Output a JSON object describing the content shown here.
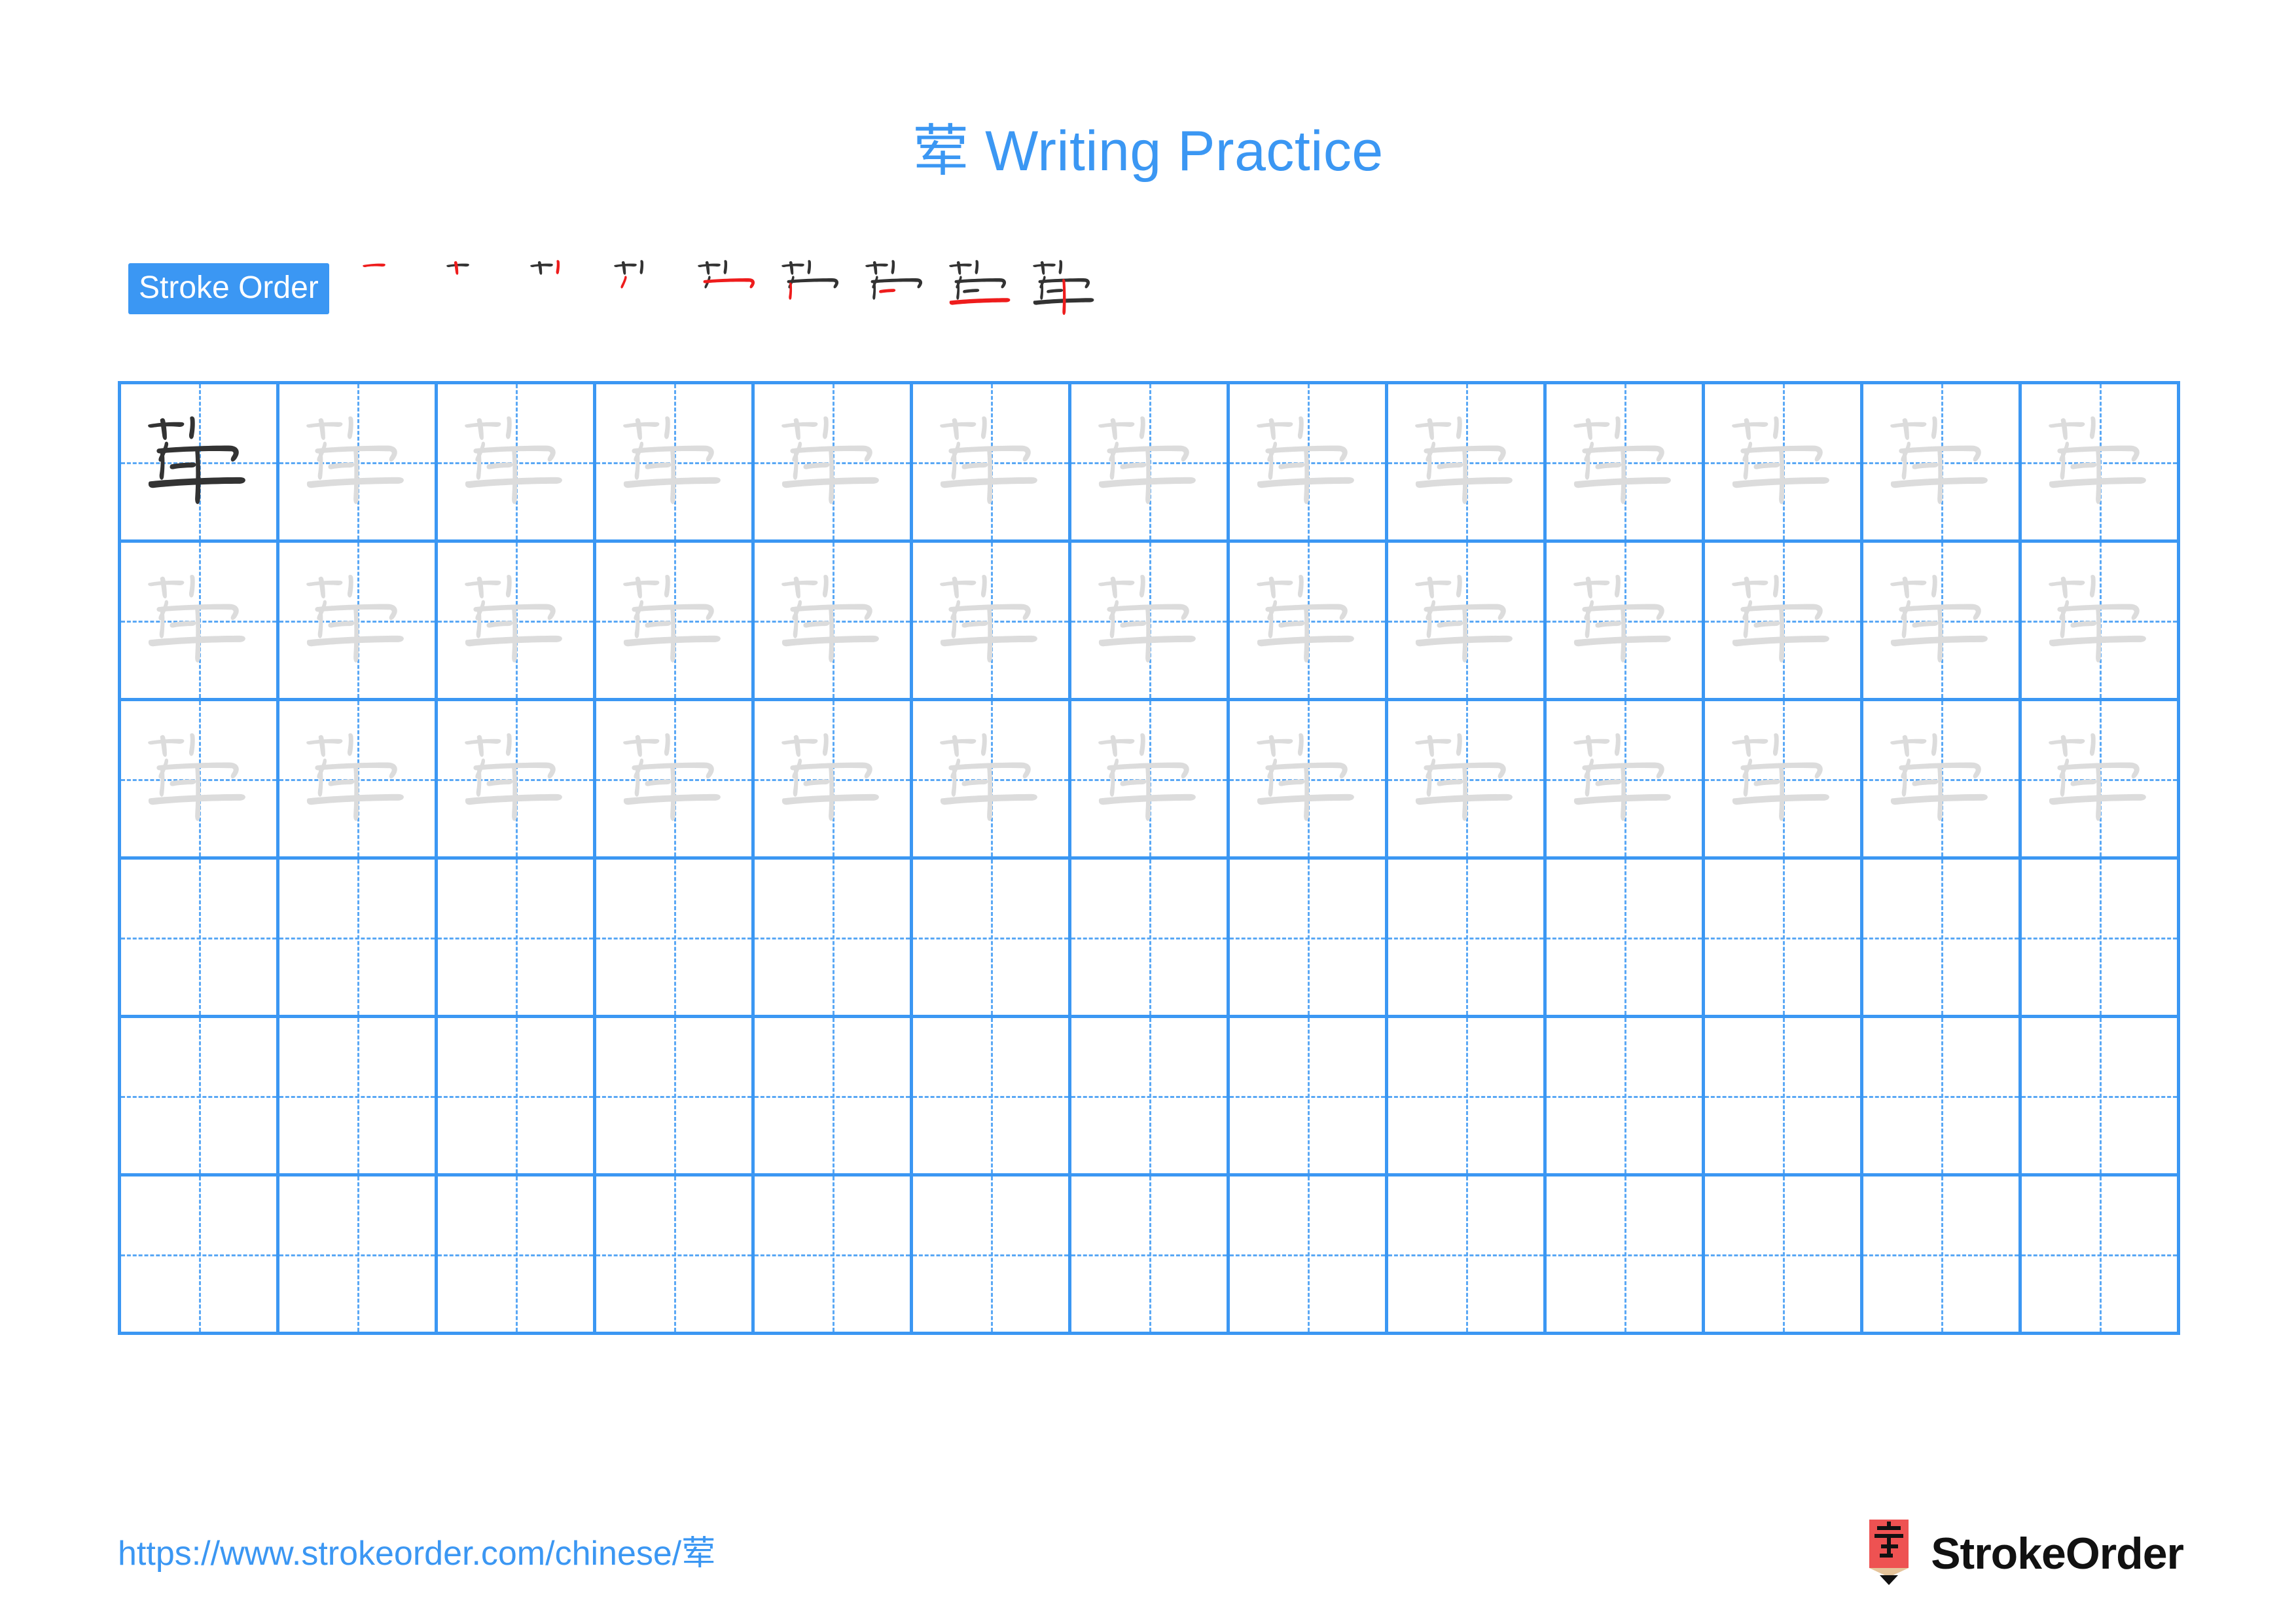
{
  "page": {
    "character": "荤",
    "title_suffix": " Writing Practice",
    "title_full": "荤 Writing Practice",
    "accent_color": "#3b97f3",
    "trace_color": "#dcdcdc",
    "ink_color": "#333333",
    "highlight_stroke_color": "#ee1c1c",
    "grid_line_color": "#3b97f3",
    "grid_dash_color": "#5aa8f5"
  },
  "stroke_order": {
    "badge_label": "Stroke Order",
    "stroke_count": 9,
    "steps": [
      {
        "index": 1,
        "name": "stroke-step-1",
        "strokes_drawn": 1
      },
      {
        "index": 2,
        "name": "stroke-step-2",
        "strokes_drawn": 2
      },
      {
        "index": 3,
        "name": "stroke-step-3",
        "strokes_drawn": 3
      },
      {
        "index": 4,
        "name": "stroke-step-4",
        "strokes_drawn": 4
      },
      {
        "index": 5,
        "name": "stroke-step-5",
        "strokes_drawn": 5
      },
      {
        "index": 6,
        "name": "stroke-step-6",
        "strokes_drawn": 6
      },
      {
        "index": 7,
        "name": "stroke-step-7",
        "strokes_drawn": 7
      },
      {
        "index": 8,
        "name": "stroke-step-8",
        "strokes_drawn": 8
      },
      {
        "index": 9,
        "name": "stroke-step-9",
        "strokes_drawn": 9
      }
    ]
  },
  "grid": {
    "columns": 13,
    "rows": 6,
    "cells": [
      [
        "ink",
        "trace",
        "trace",
        "trace",
        "trace",
        "trace",
        "trace",
        "trace",
        "trace",
        "trace",
        "trace",
        "trace",
        "trace"
      ],
      [
        "trace",
        "trace",
        "trace",
        "trace",
        "trace",
        "trace",
        "trace",
        "trace",
        "trace",
        "trace",
        "trace",
        "trace",
        "trace"
      ],
      [
        "trace",
        "trace",
        "trace",
        "trace",
        "trace",
        "trace",
        "trace",
        "trace",
        "trace",
        "trace",
        "trace",
        "trace",
        "trace"
      ],
      [
        "empty",
        "empty",
        "empty",
        "empty",
        "empty",
        "empty",
        "empty",
        "empty",
        "empty",
        "empty",
        "empty",
        "empty",
        "empty"
      ],
      [
        "empty",
        "empty",
        "empty",
        "empty",
        "empty",
        "empty",
        "empty",
        "empty",
        "empty",
        "empty",
        "empty",
        "empty",
        "empty"
      ],
      [
        "empty",
        "empty",
        "empty",
        "empty",
        "empty",
        "empty",
        "empty",
        "empty",
        "empty",
        "empty",
        "empty",
        "empty",
        "empty"
      ]
    ]
  },
  "footer": {
    "url": "https://www.strokeorder.com/chinese/荤",
    "brand_name": "StrokeOrder",
    "brand_mark_character": "字",
    "brand_mark_color": "#ee5252",
    "brand_mark_tip_color": "#e5c49a"
  }
}
